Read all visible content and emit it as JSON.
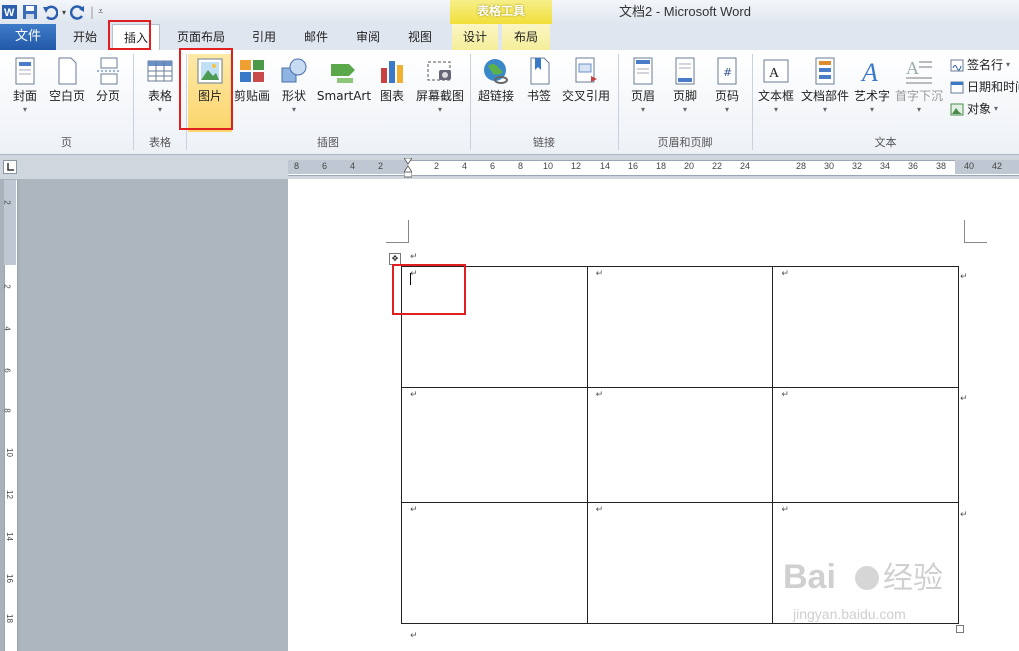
{
  "titlebar": {
    "doc_title": "文档2 - Microsoft Word",
    "context_band": "表格工具"
  },
  "tabs": {
    "file": "文件",
    "home": "开始",
    "insert": "插入",
    "page_layout": "页面布局",
    "references": "引用",
    "mailings": "邮件",
    "review": "审阅",
    "view": "视图",
    "design": "设计",
    "layout": "布局"
  },
  "ribbon": {
    "pages": {
      "label": "页",
      "cover": "封面",
      "blank": "空白页",
      "break": "分页"
    },
    "tables": {
      "label": "表格",
      "table": "表格"
    },
    "illustrations": {
      "label": "插图",
      "picture": "图片",
      "clipart": "剪贴画",
      "shapes": "形状",
      "smartart": "SmartArt",
      "chart": "图表",
      "screenshot": "屏幕截图"
    },
    "links": {
      "label": "链接",
      "hyperlink": "超链接",
      "bookmark": "书签",
      "crossref": "交叉引用"
    },
    "header_footer": {
      "label": "页眉和页脚",
      "header": "页眉",
      "footer": "页脚",
      "page_number": "页码"
    },
    "text": {
      "label": "文本",
      "textbox": "文本框",
      "quickparts": "文档部件",
      "wordart": "艺术字",
      "dropcap": "首字下沉",
      "signature": "签名行",
      "datetime": "日期和时间",
      "object": "对象"
    }
  },
  "ruler": {
    "h_left": [
      "8",
      "6",
      "4",
      "2",
      "2",
      "4",
      "6",
      "8",
      "10",
      "12"
    ],
    "h_right": [
      "14",
      "16",
      "18",
      "20",
      "22",
      "24",
      "28",
      "30",
      "32",
      "34",
      "36",
      "38",
      "40",
      "42"
    ],
    "v": [
      "2",
      "2",
      "4",
      "6",
      "8",
      "10",
      "12",
      "14",
      "16",
      "18"
    ]
  },
  "colors": {
    "accent": "#2b5fae",
    "highlight": "#e02020",
    "ctx": "#f1df3a"
  },
  "watermark": {
    "text": "Bai 经验",
    "url": "jingyan.baidu.com"
  }
}
